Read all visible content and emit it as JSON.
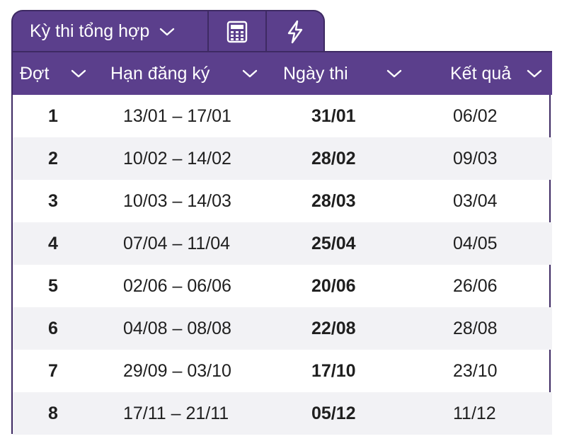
{
  "tabs": {
    "select_label": "Kỳ thi tổng hợp",
    "calculator_icon": "calculator-icon",
    "lightning_icon": "lightning-icon"
  },
  "colors": {
    "header_bg": "#5b3f8c",
    "border": "#3e2a63",
    "stripe": "#f2f2f5"
  },
  "table": {
    "headers": [
      "Đợt",
      "Hạn đăng ký",
      "Ngày thi",
      "Kết quả"
    ],
    "rows": [
      {
        "round": "1",
        "registration": "13/01 – 17/01",
        "exam_date": "31/01",
        "result": "06/02"
      },
      {
        "round": "2",
        "registration": "10/02 – 14/02",
        "exam_date": "28/02",
        "result": "09/03"
      },
      {
        "round": "3",
        "registration": "10/03 – 14/03",
        "exam_date": "28/03",
        "result": "03/04"
      },
      {
        "round": "4",
        "registration": "07/04 – 11/04",
        "exam_date": "25/04",
        "result": "04/05"
      },
      {
        "round": "5",
        "registration": "02/06 – 06/06",
        "exam_date": "20/06",
        "result": "26/06"
      },
      {
        "round": "6",
        "registration": "04/08 – 08/08",
        "exam_date": "22/08",
        "result": "28/08"
      },
      {
        "round": "7",
        "registration": "29/09 – 03/10",
        "exam_date": "17/10",
        "result": "23/10"
      },
      {
        "round": "8",
        "registration": "17/11 – 21/11",
        "exam_date": "05/12",
        "result": "11/12"
      }
    ]
  }
}
